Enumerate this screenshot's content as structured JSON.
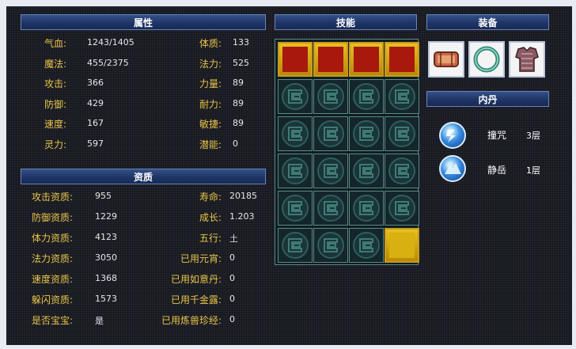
{
  "sections": {
    "attributes": "属性",
    "skills": "技能",
    "equipment": "装备",
    "inner_elixir": "内丹",
    "aptitude": "资质"
  },
  "attributes": [
    {
      "label": "气血:",
      "value": "1243/1405",
      "label2": "体质:",
      "value2": "133"
    },
    {
      "label": "魔法:",
      "value": "455/2375",
      "label2": "法力:",
      "value2": "525"
    },
    {
      "label": "攻击:",
      "value": "366",
      "label2": "力量:",
      "value2": "89"
    },
    {
      "label": "防御:",
      "value": "429",
      "label2": "耐力:",
      "value2": "89"
    },
    {
      "label": "速度:",
      "value": "167",
      "label2": "敏捷:",
      "value2": "89"
    },
    {
      "label": "灵力:",
      "value": "597",
      "label2": "潜能:",
      "value2": "0"
    }
  ],
  "aptitude": [
    {
      "label": "攻击资质:",
      "value": "955",
      "label2": "寿命:",
      "value2": "20185"
    },
    {
      "label": "防御资质:",
      "value": "1229",
      "label2": "成长:",
      "value2": "1.203"
    },
    {
      "label": "体力资质:",
      "value": "4123",
      "label2": "五行:",
      "value2": "土"
    },
    {
      "label": "法力资质:",
      "value": "3050",
      "label2": "已用元宵:",
      "value2": "0"
    },
    {
      "label": "速度资质:",
      "value": "1368",
      "label2": "已用如意丹:",
      "value2": "0"
    },
    {
      "label": "躲闪资质:",
      "value": "1573",
      "label2": "已用千金露:",
      "value2": "0"
    },
    {
      "label": "是否宝宝:",
      "value": "是",
      "label2": "已用炼兽珍经:",
      "value2": "0"
    }
  ],
  "skill_icons": [
    "claw-strike-icon",
    "warrior-silhouette-icon",
    "broken-shield-icon",
    "heart-pact-icon",
    "triple-orb-icon"
  ],
  "equipment_icons": [
    "bracer-icon",
    "jade-ring-icon",
    "armor-icon"
  ],
  "inner_elixirs": [
    {
      "name": "撞咒",
      "level": "3层",
      "icon": "lightning-orb-icon"
    },
    {
      "name": "静岳",
      "level": "1层",
      "icon": "mountain-orb-icon"
    }
  ],
  "colors": {
    "label_gold": "#e8c448",
    "value_white": "#e6e6e6",
    "header_blue": "#1f3566",
    "slot_teal": "#5b8a86",
    "skill_gold": "#c89a20"
  }
}
